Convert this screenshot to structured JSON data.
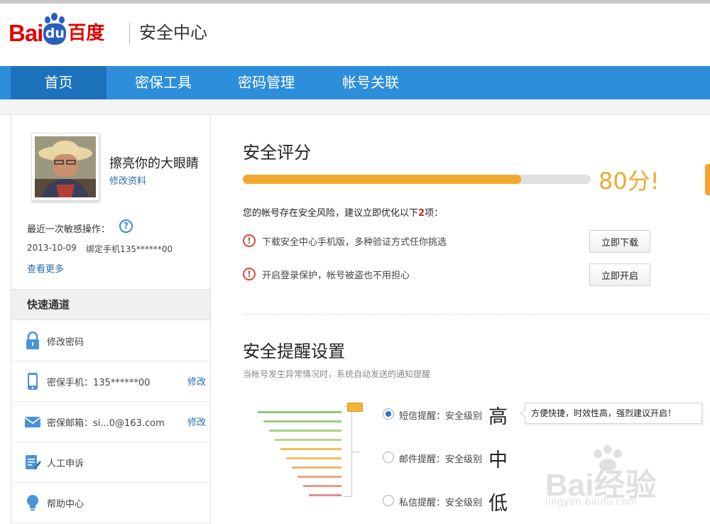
{
  "header": {
    "logo": {
      "text_bai": "Bai",
      "text_du": "du",
      "text_cn": "百度"
    },
    "site_title": "安全中心"
  },
  "nav": {
    "items": [
      {
        "label": "首页",
        "active": true
      },
      {
        "label": "密保工具",
        "active": false
      },
      {
        "label": "密码管理",
        "active": false
      },
      {
        "label": "帐号关联",
        "active": false
      }
    ]
  },
  "sidebar": {
    "user": {
      "name": "擦亮你的大眼睛",
      "edit_profile": "修改资料"
    },
    "recent": {
      "label": "最近一次敏感操作：",
      "help_icon": "?",
      "date": "2013-10-09",
      "action": "绑定手机135******00",
      "see_more": "查看更多"
    },
    "quick": {
      "title": "快速通道",
      "items": [
        {
          "icon": "lock-icon",
          "label": "修改密码",
          "edit": ""
        },
        {
          "icon": "phone-icon",
          "label": "密保手机：135******00",
          "edit": "修改"
        },
        {
          "icon": "mail-icon",
          "label": "密保邮箱：si...0@163.com",
          "edit": "修改"
        },
        {
          "icon": "appeal-icon",
          "label": "人工申诉",
          "edit": ""
        },
        {
          "icon": "lightbulb-icon",
          "label": "帮助中心",
          "edit": ""
        }
      ]
    }
  },
  "score": {
    "title": "安全评分",
    "value": 80,
    "max": 100,
    "value_text": "80分!",
    "risk_before": "您的帐号存在安全风险，建议立即优化以下",
    "risk_count": "2",
    "risk_after": "项：",
    "recommendations": [
      {
        "text": "下载安全中心手机版，多种验证方式任你挑选",
        "button": "立即下载"
      },
      {
        "text": "开启登录保护，帐号被盗也不用担心",
        "button": "立即开启"
      }
    ]
  },
  "reminder": {
    "title": "安全提醒设置",
    "desc": "当帐号发生异常情况时，系统自动发送的通知提醒",
    "options": [
      {
        "label": "短信提醒：安全级别",
        "level": "高",
        "selected": true
      },
      {
        "label": "邮件提醒：安全级别",
        "level": "中",
        "selected": false
      },
      {
        "label": "私信提醒：安全级别",
        "level": "低",
        "selected": false
      }
    ],
    "tooltip": "方便快捷，时效性高，强烈建议开启！",
    "funnel_colors": [
      "#8fc67c",
      "#9ccc82",
      "#a8d08a",
      "#b7d594",
      "#efc25a",
      "#eec064",
      "#eeb573",
      "#eba77d",
      "#e79b85",
      "#e38f8f"
    ]
  },
  "watermark": {
    "brand": "Bai经验",
    "url": "jingyan.baidu.com"
  },
  "colors": {
    "nav": "#2d8fdc",
    "nav_active": "#1d72bc",
    "brand_red": "#e10601",
    "accent_orange": "#f0a82f",
    "link": "#2b6cb5"
  }
}
